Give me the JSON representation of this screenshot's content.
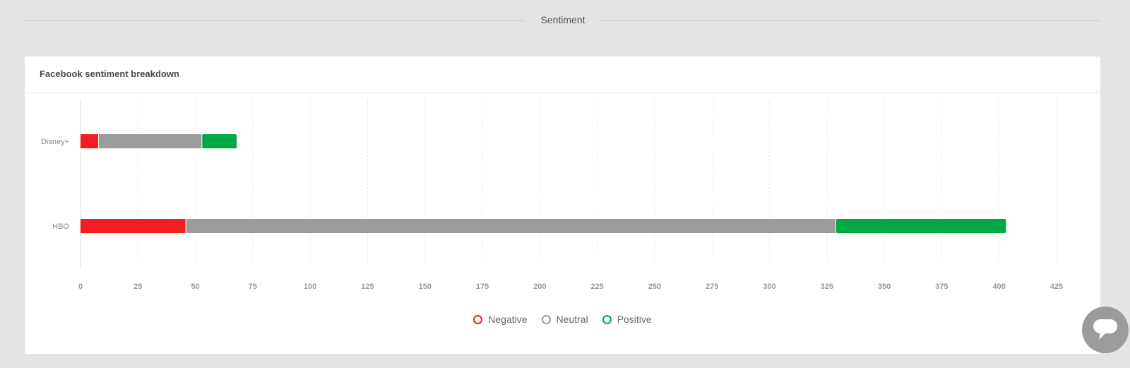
{
  "section": {
    "title": "Sentiment"
  },
  "card": {
    "title": "Facebook sentiment breakdown"
  },
  "chart_data": {
    "type": "bar",
    "orientation": "horizontal",
    "stacked": true,
    "categories": [
      "Disney+",
      "HBO"
    ],
    "series": [
      {
        "name": "Negative",
        "values": [
          8,
          46
        ],
        "color": "#f21e23"
      },
      {
        "name": "Neutral",
        "values": [
          45,
          283
        ],
        "color": "#9b9b9b"
      },
      {
        "name": "Positive",
        "values": [
          15,
          74
        ],
        "color": "#00a843"
      }
    ],
    "xlim": [
      0,
      425
    ],
    "x_ticks": [
      "0",
      "25",
      "50",
      "75",
      "100",
      "125",
      "150",
      "175",
      "200",
      "225",
      "250",
      "275",
      "300",
      "325",
      "350",
      "375",
      "400",
      "425"
    ],
    "grid": true,
    "legend": "bottom-center"
  },
  "chat": {
    "icon": "chat-bubble-icon"
  }
}
